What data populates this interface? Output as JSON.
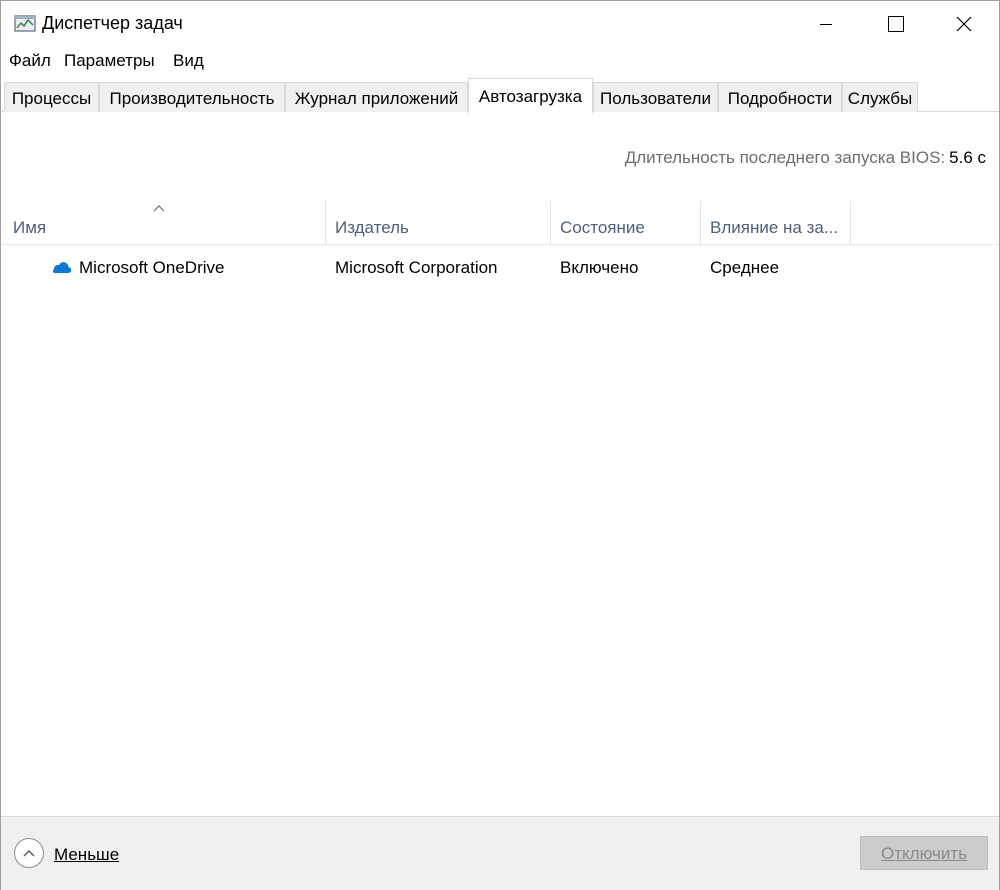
{
  "window": {
    "title": "Диспетчер задач",
    "icon": "task-manager-icon"
  },
  "menu": [
    {
      "label": "Файл",
      "access_key": "Ф"
    },
    {
      "label": "Параметры",
      "access_key": "П"
    },
    {
      "label": "Вид",
      "access_key": "В"
    }
  ],
  "tabs": [
    {
      "label": "Процессы",
      "active": false
    },
    {
      "label": "Производительность",
      "active": false
    },
    {
      "label": "Журнал приложений",
      "active": false
    },
    {
      "label": "Автозагрузка",
      "active": true
    },
    {
      "label": "Пользователи",
      "active": false
    },
    {
      "label": "Подробности",
      "active": false
    },
    {
      "label": "Службы",
      "active": false
    }
  ],
  "bios": {
    "label": "Длительность последнего запуска BIOS:",
    "value": "5.6 с"
  },
  "table": {
    "columns": [
      "Имя",
      "Издатель",
      "Состояние",
      "Влияние на за..."
    ],
    "sorted_column": "Имя",
    "sort_direction": "ascending",
    "rows": [
      {
        "icon": "onedrive-cloud-icon",
        "name": "Microsoft OneDrive",
        "publisher": "Microsoft Corporation",
        "state": "Включено",
        "impact": "Среднее"
      }
    ]
  },
  "footer": {
    "less_label": "Меньше",
    "disable_label": "Отключить",
    "disable_enabled": false
  },
  "colors": {
    "header_text": "#4c607a",
    "secondary_text": "#6d6d6d",
    "onedrive_blue": "#0f78d4",
    "tab_inactive_bg": "#f0f0f0",
    "footer_bg": "#f0f0f0",
    "disabled_button_bg": "#cccccc"
  }
}
